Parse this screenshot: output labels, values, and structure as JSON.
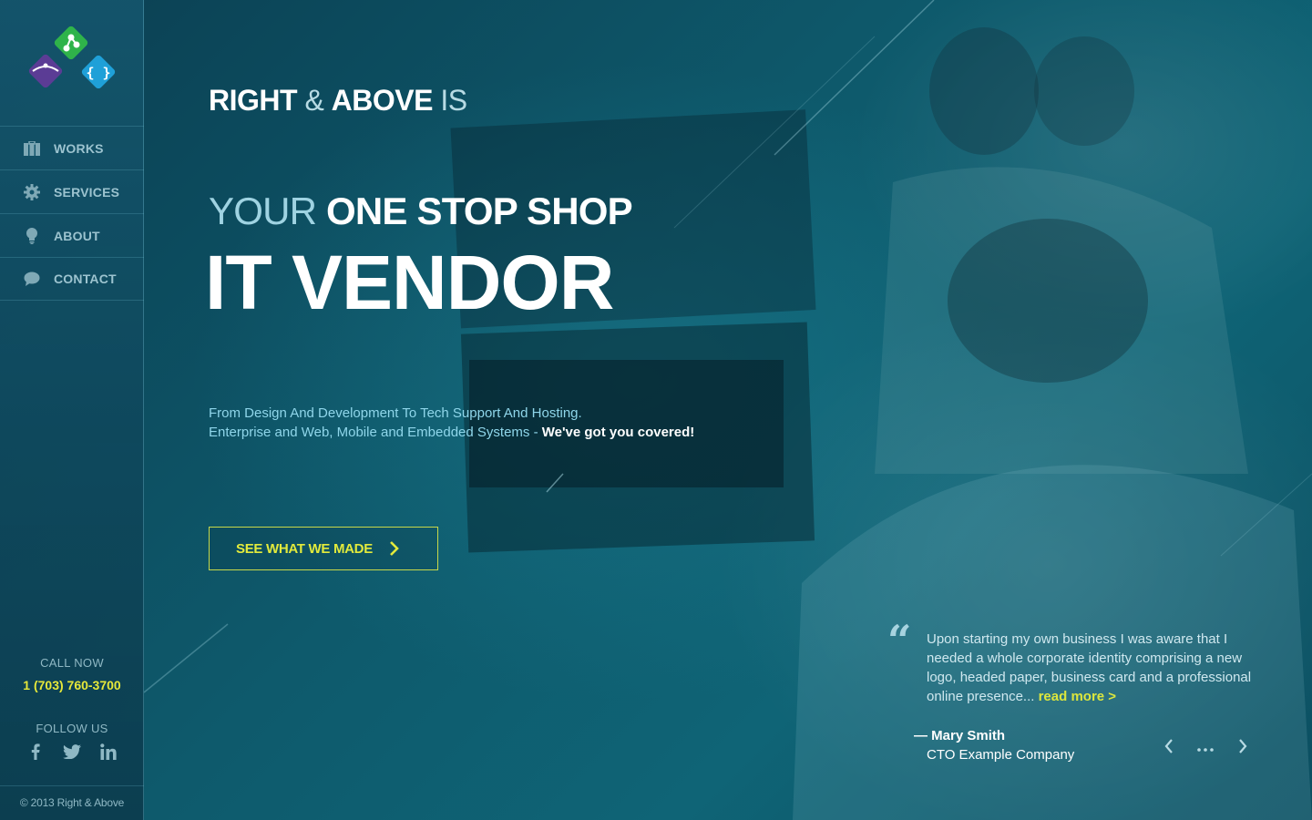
{
  "brand": {
    "name": "Right & Above",
    "colors": {
      "accent": "#e2ea3c",
      "logo_green": "#2fb34a",
      "logo_purple": "#5b3c95",
      "logo_blue": "#1fa0d8"
    }
  },
  "sidebar": {
    "nav": [
      {
        "label": "WORKS",
        "icon": "briefcase-icon"
      },
      {
        "label": "SERVICES",
        "icon": "gear-icon"
      },
      {
        "label": "ABOUT",
        "icon": "lightbulb-icon"
      },
      {
        "label": "CONTACT",
        "icon": "chat-bubble-icon"
      }
    ],
    "call_label": "CALL NOW",
    "call_number": "1 (703) 760-3700",
    "follow_label": "FOLLOW US",
    "socials": [
      "facebook-icon",
      "twitter-icon",
      "linkedin-icon"
    ],
    "copyright": "© 2013 Right & Above"
  },
  "hero": {
    "kicker_right": "RIGHT",
    "kicker_amp": "&",
    "kicker_above": "ABOVE",
    "kicker_is": "IS",
    "line1_light": "YOUR",
    "line1_bold": "ONE STOP SHOP",
    "line2": "IT VENDOR",
    "desc_line1": "From Design And Development To Tech Support And Hosting.",
    "desc_line2": "Enterprise and Web, Mobile and Embedded Systems -",
    "desc_highlight": "We've got you covered!",
    "cta_label": "SEE WHAT WE MADE"
  },
  "testimonial": {
    "quote": "Upon starting my own business I was aware that I needed a whole corporate identity comprising a new logo, headed paper, business card and a professional online presence...",
    "read_more": "read more >",
    "author_name": "— Mary Smith",
    "author_title": "CTO Example Company"
  }
}
